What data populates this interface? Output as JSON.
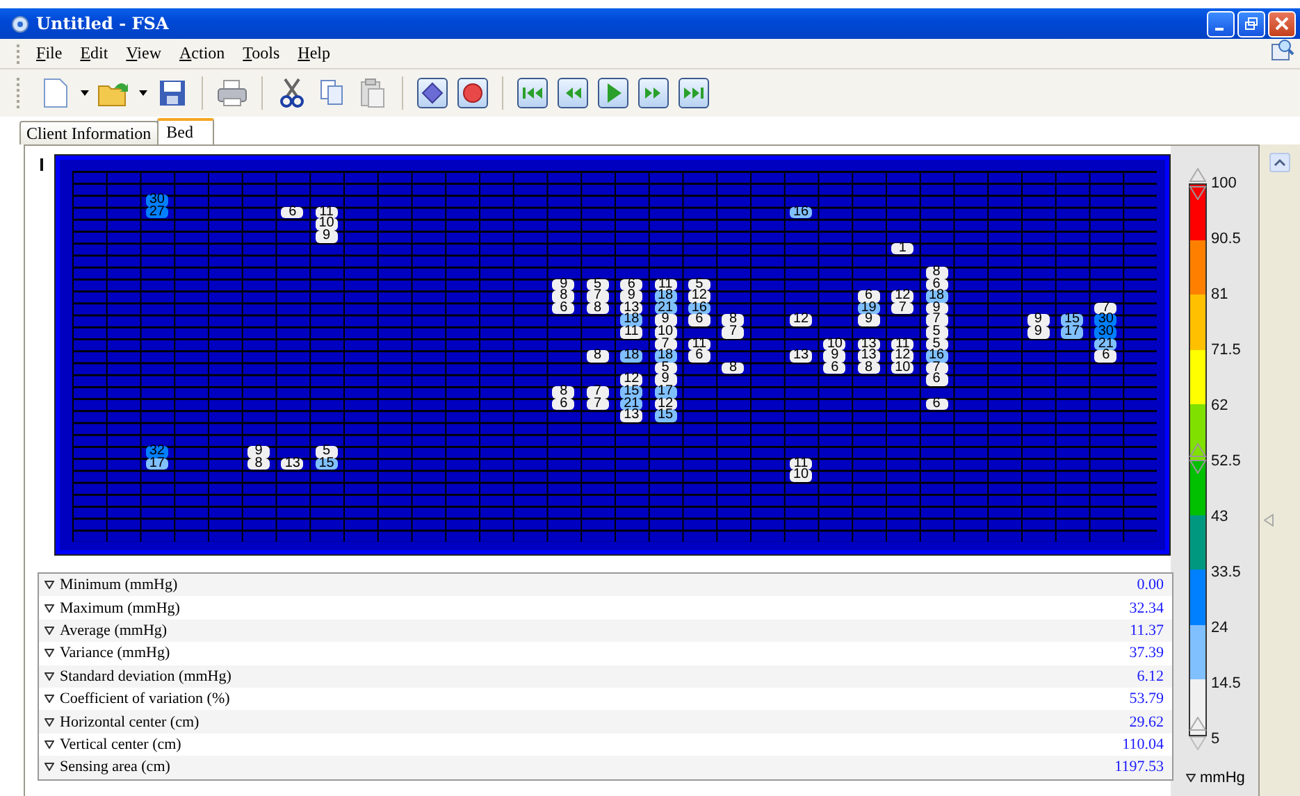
{
  "window": {
    "title": "Untitled - FSA"
  },
  "menu": [
    {
      "label": "File"
    },
    {
      "label": "Edit"
    },
    {
      "label": "View"
    },
    {
      "label": "Action"
    },
    {
      "label": "Tools"
    },
    {
      "label": "Help"
    }
  ],
  "tabs": [
    {
      "label": "Client Information",
      "selected": false
    },
    {
      "label": "Bed",
      "selected": true
    }
  ],
  "pressure_map": {
    "rows": [
      [
        null,
        null,
        null,
        null,
        null,
        null,
        null,
        null,
        null,
        null,
        null,
        null,
        null,
        null,
        null,
        null,
        null,
        null,
        null,
        null,
        null,
        null,
        null,
        null,
        null,
        null,
        null,
        null,
        null,
        null,
        null,
        null
      ],
      [
        null,
        null,
        null,
        null,
        null,
        null,
        null,
        null,
        null,
        null,
        null,
        null,
        null,
        null,
        null,
        null,
        null,
        null,
        null,
        null,
        null,
        null,
        null,
        null,
        null,
        null,
        null,
        null,
        null,
        null,
        null,
        null
      ],
      [
        null,
        null,
        {
          "value": "30",
          "color": "#0080ff"
        },
        null,
        null,
        null,
        null,
        null,
        null,
        null,
        null,
        null,
        null,
        null,
        null,
        null,
        null,
        null,
        null,
        null,
        null,
        null,
        null,
        null,
        null,
        null,
        null,
        null,
        null,
        null,
        null,
        null
      ],
      [
        null,
        null,
        {
          "value": "27",
          "color": "#0080ff"
        },
        null,
        null,
        null,
        {
          "value": "6",
          "color": "#f0f0f0"
        },
        {
          "value": "11",
          "color": "#f0f0f0"
        },
        null,
        null,
        null,
        null,
        null,
        null,
        null,
        null,
        null,
        null,
        null,
        null,
        null,
        {
          "value": "16",
          "color": "#80c0ff"
        },
        null,
        null,
        null,
        null,
        null,
        null,
        null,
        null,
        null,
        null
      ],
      [
        null,
        null,
        null,
        null,
        null,
        null,
        null,
        {
          "value": "10",
          "color": "#f0f0f0"
        },
        null,
        null,
        null,
        null,
        null,
        null,
        null,
        null,
        null,
        null,
        null,
        null,
        null,
        null,
        null,
        null,
        null,
        null,
        null,
        null,
        null,
        null,
        null,
        null
      ],
      [
        null,
        null,
        null,
        null,
        null,
        null,
        null,
        {
          "value": "9",
          "color": "#f0f0f0"
        },
        null,
        null,
        null,
        null,
        null,
        null,
        null,
        null,
        null,
        null,
        null,
        null,
        null,
        null,
        null,
        null,
        null,
        null,
        null,
        null,
        null,
        null,
        null,
        null
      ],
      [
        null,
        null,
        null,
        null,
        null,
        null,
        null,
        null,
        null,
        null,
        null,
        null,
        null,
        null,
        null,
        null,
        null,
        null,
        null,
        null,
        null,
        null,
        null,
        null,
        {
          "value": "1",
          "color": "#f0f0f0"
        },
        null,
        null,
        null,
        null,
        null,
        null,
        null
      ],
      [
        null,
        null,
        null,
        null,
        null,
        null,
        null,
        null,
        null,
        null,
        null,
        null,
        null,
        null,
        null,
        null,
        null,
        null,
        null,
        null,
        null,
        null,
        null,
        null,
        null,
        null,
        null,
        null,
        null,
        null,
        null,
        null
      ],
      [
        null,
        null,
        null,
        null,
        null,
        null,
        null,
        null,
        null,
        null,
        null,
        null,
        null,
        null,
        null,
        null,
        null,
        null,
        null,
        null,
        null,
        null,
        null,
        null,
        null,
        {
          "value": "8",
          "color": "#f0f0f0"
        },
        null,
        null,
        null,
        null,
        null,
        null
      ],
      [
        null,
        null,
        null,
        null,
        null,
        null,
        null,
        null,
        null,
        null,
        null,
        null,
        null,
        null,
        {
          "value": "9",
          "color": "#f0f0f0"
        },
        {
          "value": "5",
          "color": "#f0f0f0"
        },
        {
          "value": "6",
          "color": "#f0f0f0"
        },
        {
          "value": "11",
          "color": "#f0f0f0"
        },
        {
          "value": "5",
          "color": "#f0f0f0"
        },
        null,
        null,
        null,
        null,
        null,
        null,
        {
          "value": "6",
          "color": "#f0f0f0"
        },
        null,
        null,
        null,
        null,
        null,
        null
      ],
      [
        null,
        null,
        null,
        null,
        null,
        null,
        null,
        null,
        null,
        null,
        null,
        null,
        null,
        null,
        {
          "value": "8",
          "color": "#f0f0f0"
        },
        {
          "value": "7",
          "color": "#f0f0f0"
        },
        {
          "value": "9",
          "color": "#f0f0f0"
        },
        {
          "value": "18",
          "color": "#80c0ff"
        },
        {
          "value": "12",
          "color": "#f0f0f0"
        },
        null,
        null,
        null,
        null,
        {
          "value": "6",
          "color": "#f0f0f0"
        },
        {
          "value": "12",
          "color": "#f0f0f0"
        },
        {
          "value": "18",
          "color": "#80c0ff"
        },
        null,
        null,
        null,
        null,
        null,
        null
      ],
      [
        null,
        null,
        null,
        null,
        null,
        null,
        null,
        null,
        null,
        null,
        null,
        null,
        null,
        null,
        {
          "value": "6",
          "color": "#f0f0f0"
        },
        {
          "value": "8",
          "color": "#f0f0f0"
        },
        {
          "value": "13",
          "color": "#f0f0f0"
        },
        {
          "value": "21",
          "color": "#80c0ff"
        },
        {
          "value": "16",
          "color": "#80c0ff"
        },
        null,
        null,
        null,
        null,
        {
          "value": "19",
          "color": "#80c0ff"
        },
        {
          "value": "7",
          "color": "#f0f0f0"
        },
        {
          "value": "9",
          "color": "#f0f0f0"
        },
        null,
        null,
        null,
        null,
        {
          "value": "7",
          "color": "#f0f0f0"
        },
        null
      ],
      [
        null,
        null,
        null,
        null,
        null,
        null,
        null,
        null,
        null,
        null,
        null,
        null,
        null,
        null,
        null,
        null,
        {
          "value": "18",
          "color": "#80c0ff"
        },
        {
          "value": "9",
          "color": "#f0f0f0"
        },
        {
          "value": "6",
          "color": "#f0f0f0"
        },
        {
          "value": "8",
          "color": "#f0f0f0"
        },
        null,
        {
          "value": "12",
          "color": "#f0f0f0"
        },
        null,
        {
          "value": "9",
          "color": "#f0f0f0"
        },
        null,
        {
          "value": "7",
          "color": "#f0f0f0"
        },
        null,
        null,
        {
          "value": "9",
          "color": "#f0f0f0"
        },
        {
          "value": "15",
          "color": "#80c0ff"
        },
        {
          "value": "30",
          "color": "#0080ff"
        },
        null
      ],
      [
        null,
        null,
        null,
        null,
        null,
        null,
        null,
        null,
        null,
        null,
        null,
        null,
        null,
        null,
        null,
        null,
        {
          "value": "11",
          "color": "#f0f0f0"
        },
        {
          "value": "10",
          "color": "#f0f0f0"
        },
        null,
        {
          "value": "7",
          "color": "#f0f0f0"
        },
        null,
        null,
        null,
        null,
        null,
        {
          "value": "5",
          "color": "#f0f0f0"
        },
        null,
        null,
        {
          "value": "9",
          "color": "#f0f0f0"
        },
        {
          "value": "17",
          "color": "#80c0ff"
        },
        {
          "value": "30",
          "color": "#0080ff"
        },
        null
      ],
      [
        null,
        null,
        null,
        null,
        null,
        null,
        null,
        null,
        null,
        null,
        null,
        null,
        null,
        null,
        null,
        null,
        null,
        {
          "value": "7",
          "color": "#f0f0f0"
        },
        {
          "value": "11",
          "color": "#f0f0f0"
        },
        null,
        null,
        null,
        {
          "value": "10",
          "color": "#f0f0f0"
        },
        {
          "value": "13",
          "color": "#f0f0f0"
        },
        {
          "value": "11",
          "color": "#f0f0f0"
        },
        {
          "value": "5",
          "color": "#f0f0f0"
        },
        null,
        null,
        null,
        null,
        {
          "value": "21",
          "color": "#80c0ff"
        },
        null
      ],
      [
        null,
        null,
        null,
        null,
        null,
        null,
        null,
        null,
        null,
        null,
        null,
        null,
        null,
        null,
        null,
        {
          "value": "8",
          "color": "#f0f0f0"
        },
        {
          "value": "18",
          "color": "#80c0ff"
        },
        {
          "value": "18",
          "color": "#80c0ff"
        },
        {
          "value": "6",
          "color": "#f0f0f0"
        },
        null,
        null,
        {
          "value": "13",
          "color": "#f0f0f0"
        },
        {
          "value": "9",
          "color": "#f0f0f0"
        },
        {
          "value": "13",
          "color": "#f0f0f0"
        },
        {
          "value": "12",
          "color": "#f0f0f0"
        },
        {
          "value": "16",
          "color": "#80c0ff"
        },
        null,
        null,
        null,
        null,
        {
          "value": "6",
          "color": "#f0f0f0"
        },
        null
      ],
      [
        null,
        null,
        null,
        null,
        null,
        null,
        null,
        null,
        null,
        null,
        null,
        null,
        null,
        null,
        null,
        null,
        null,
        {
          "value": "5",
          "color": "#f0f0f0"
        },
        null,
        {
          "value": "8",
          "color": "#f0f0f0"
        },
        null,
        null,
        {
          "value": "6",
          "color": "#f0f0f0"
        },
        {
          "value": "8",
          "color": "#f0f0f0"
        },
        {
          "value": "10",
          "color": "#f0f0f0"
        },
        {
          "value": "7",
          "color": "#f0f0f0"
        },
        null,
        null,
        null,
        null,
        null,
        null
      ],
      [
        null,
        null,
        null,
        null,
        null,
        null,
        null,
        null,
        null,
        null,
        null,
        null,
        null,
        null,
        null,
        null,
        {
          "value": "12",
          "color": "#f0f0f0"
        },
        {
          "value": "9",
          "color": "#f0f0f0"
        },
        null,
        null,
        null,
        null,
        null,
        null,
        null,
        {
          "value": "6",
          "color": "#f0f0f0"
        },
        null,
        null,
        null,
        null,
        null,
        null
      ],
      [
        null,
        null,
        null,
        null,
        null,
        null,
        null,
        null,
        null,
        null,
        null,
        null,
        null,
        null,
        {
          "value": "8",
          "color": "#f0f0f0"
        },
        {
          "value": "7",
          "color": "#f0f0f0"
        },
        {
          "value": "15",
          "color": "#80c0ff"
        },
        {
          "value": "17",
          "color": "#80c0ff"
        },
        null,
        null,
        null,
        null,
        null,
        null,
        null,
        null,
        null,
        null,
        null,
        null,
        null,
        null
      ],
      [
        null,
        null,
        null,
        null,
        null,
        null,
        null,
        null,
        null,
        null,
        null,
        null,
        null,
        null,
        {
          "value": "6",
          "color": "#f0f0f0"
        },
        {
          "value": "7",
          "color": "#f0f0f0"
        },
        {
          "value": "21",
          "color": "#80c0ff"
        },
        {
          "value": "12",
          "color": "#f0f0f0"
        },
        null,
        null,
        null,
        null,
        null,
        null,
        null,
        {
          "value": "6",
          "color": "#f0f0f0"
        },
        null,
        null,
        null,
        null,
        null,
        null
      ],
      [
        null,
        null,
        null,
        null,
        null,
        null,
        null,
        null,
        null,
        null,
        null,
        null,
        null,
        null,
        null,
        null,
        {
          "value": "13",
          "color": "#f0f0f0"
        },
        {
          "value": "15",
          "color": "#80c0ff"
        },
        null,
        null,
        null,
        null,
        null,
        null,
        null,
        null,
        null,
        null,
        null,
        null,
        null,
        null
      ],
      [
        null,
        null,
        null,
        null,
        null,
        null,
        null,
        null,
        null,
        null,
        null,
        null,
        null,
        null,
        null,
        null,
        null,
        null,
        null,
        null,
        null,
        null,
        null,
        null,
        null,
        null,
        null,
        null,
        null,
        null,
        null,
        null
      ],
      [
        null,
        null,
        null,
        null,
        null,
        null,
        null,
        null,
        null,
        null,
        null,
        null,
        null,
        null,
        null,
        null,
        null,
        null,
        null,
        null,
        null,
        null,
        null,
        null,
        null,
        null,
        null,
        null,
        null,
        null,
        null,
        null
      ],
      [
        null,
        null,
        {
          "value": "32",
          "color": "#0080ff"
        },
        null,
        null,
        {
          "value": "9",
          "color": "#f0f0f0"
        },
        null,
        {
          "value": "5",
          "color": "#f0f0f0"
        },
        null,
        null,
        null,
        null,
        null,
        null,
        null,
        null,
        null,
        null,
        null,
        null,
        null,
        null,
        null,
        null,
        null,
        null,
        null,
        null,
        null,
        null,
        null,
        null
      ],
      [
        null,
        null,
        {
          "value": "17",
          "color": "#80c0ff"
        },
        null,
        null,
        {
          "value": "8",
          "color": "#f0f0f0"
        },
        {
          "value": "13",
          "color": "#f0f0f0"
        },
        {
          "value": "15",
          "color": "#80c0ff"
        },
        null,
        null,
        null,
        null,
        null,
        null,
        null,
        null,
        null,
        null,
        null,
        null,
        null,
        {
          "value": "11",
          "color": "#f0f0f0"
        },
        null,
        null,
        null,
        null,
        null,
        null,
        null,
        null,
        null,
        null
      ],
      [
        null,
        null,
        null,
        null,
        null,
        null,
        null,
        null,
        null,
        null,
        null,
        null,
        null,
        null,
        null,
        null,
        null,
        null,
        null,
        null,
        null,
        {
          "value": "10",
          "color": "#f0f0f0"
        },
        null,
        null,
        null,
        null,
        null,
        null,
        null,
        null,
        null,
        null
      ],
      [
        null,
        null,
        null,
        null,
        null,
        null,
        null,
        null,
        null,
        null,
        null,
        null,
        null,
        null,
        null,
        null,
        null,
        null,
        null,
        null,
        null,
        null,
        null,
        null,
        null,
        null,
        null,
        null,
        null,
        null,
        null,
        null
      ],
      [
        null,
        null,
        null,
        null,
        null,
        null,
        null,
        null,
        null,
        null,
        null,
        null,
        null,
        null,
        null,
        null,
        null,
        null,
        null,
        null,
        null,
        null,
        null,
        null,
        null,
        null,
        null,
        null,
        null,
        null,
        null,
        null
      ],
      [
        null,
        null,
        null,
        null,
        null,
        null,
        null,
        null,
        null,
        null,
        null,
        null,
        null,
        null,
        null,
        null,
        null,
        null,
        null,
        null,
        null,
        null,
        null,
        null,
        null,
        null,
        null,
        null,
        null,
        null,
        null,
        null
      ],
      [
        null,
        null,
        null,
        null,
        null,
        null,
        null,
        null,
        null,
        null,
        null,
        null,
        null,
        null,
        null,
        null,
        null,
        null,
        null,
        null,
        null,
        null,
        null,
        null,
        null,
        null,
        null,
        null,
        null,
        null,
        null,
        null
      ],
      [
        null,
        null,
        null,
        null,
        null,
        null,
        null,
        null,
        null,
        null,
        null,
        null,
        null,
        null,
        null,
        null,
        null,
        null,
        null,
        null,
        null,
        null,
        null,
        null,
        null,
        null,
        null,
        null,
        null,
        null,
        null,
        null
      ]
    ]
  },
  "statistics": [
    {
      "label": "Minimum (mmHg)",
      "value": "0.00"
    },
    {
      "label": "Maximum (mmHg)",
      "value": "32.34"
    },
    {
      "label": "Average (mmHg)",
      "value": "11.37"
    },
    {
      "label": "Variance (mmHg)",
      "value": "37.39"
    },
    {
      "label": "Standard deviation (mmHg)",
      "value": "6.12"
    },
    {
      "label": "Coefficient of variation (%)",
      "value": "53.79"
    },
    {
      "label": "Horizontal center (cm)",
      "value": "29.62"
    },
    {
      "label": "Vertical center (cm)",
      "value": "110.04"
    },
    {
      "label": "Sensing area (cm)",
      "value": "1197.53"
    }
  ],
  "legend": {
    "labels": [
      "100",
      "90.5",
      "81",
      "71.5",
      "62",
      "52.5",
      "43",
      "33.5",
      "24",
      "14.5",
      "5"
    ],
    "bands": [
      {
        "color": "#ff0000"
      },
      {
        "color": "#ff8000"
      },
      {
        "color": "#ffc000"
      },
      {
        "color": "#ffff00"
      },
      {
        "color": "#80e000"
      },
      {
        "color": "#00c000"
      },
      {
        "color": "#009980"
      },
      {
        "color": "#0080ff"
      },
      {
        "color": "#80c0ff"
      },
      {
        "color": "#f0f0f0"
      }
    ],
    "unit": "mmHg"
  }
}
